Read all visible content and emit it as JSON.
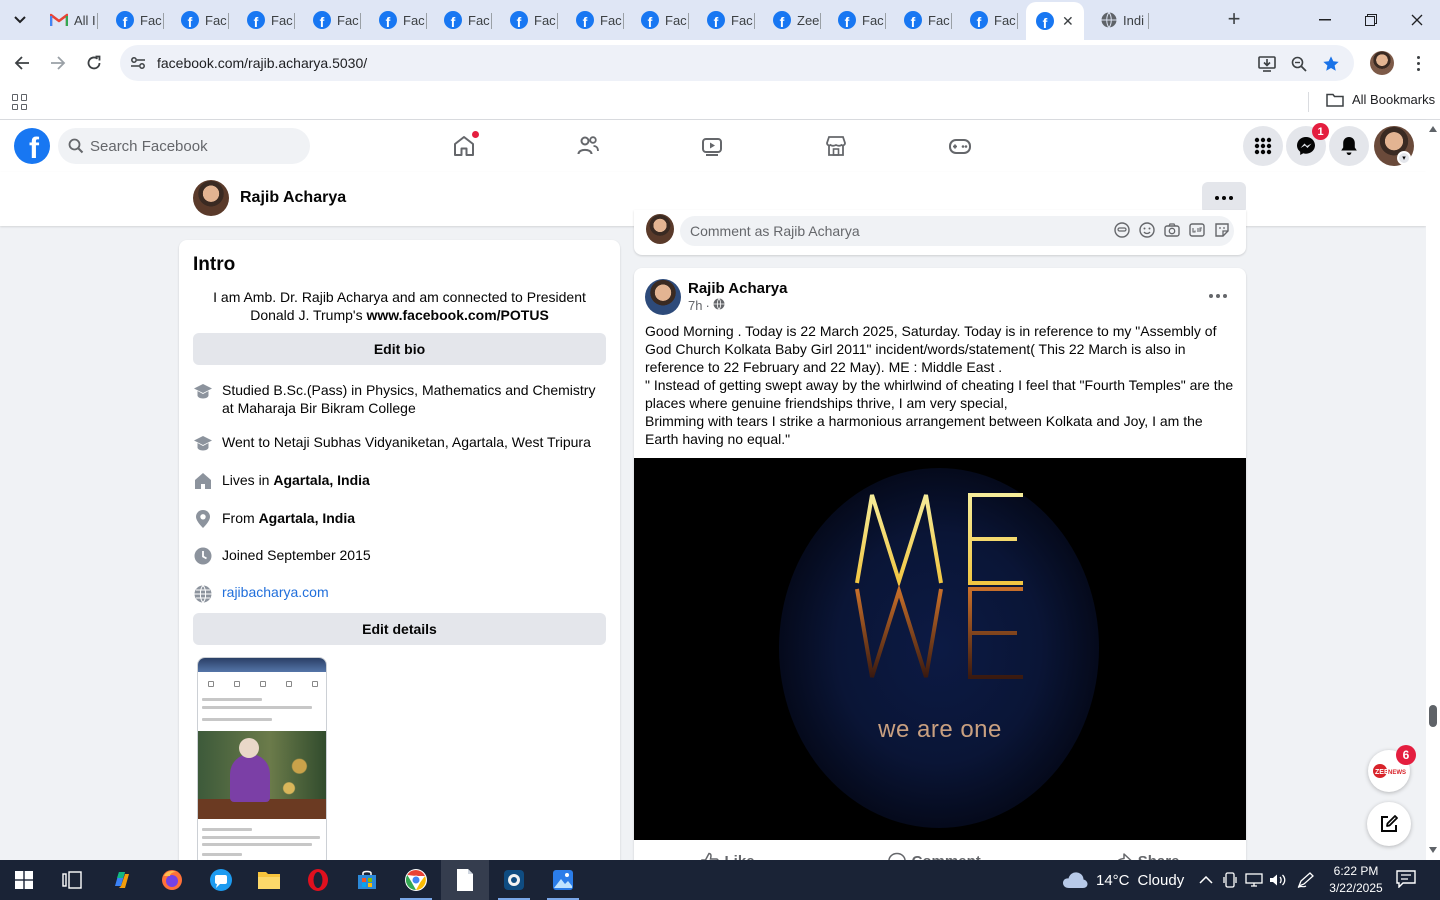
{
  "browser": {
    "tabs": [
      {
        "label": "All I",
        "type": "gmail",
        "active": false
      },
      {
        "label": "Fac",
        "type": "facebook",
        "active": false
      },
      {
        "label": "Fac",
        "type": "facebook",
        "active": false
      },
      {
        "label": "Fac",
        "type": "facebook",
        "active": false
      },
      {
        "label": "Fac",
        "type": "facebook",
        "active": false
      },
      {
        "label": "Fac",
        "type": "facebook",
        "active": false
      },
      {
        "label": "Fac",
        "type": "facebook",
        "active": false
      },
      {
        "label": "Fac",
        "type": "facebook",
        "active": false
      },
      {
        "label": "Fac",
        "type": "facebook",
        "active": false
      },
      {
        "label": "Fac",
        "type": "facebook",
        "active": false
      },
      {
        "label": "Fac",
        "type": "facebook",
        "active": false
      },
      {
        "label": "Zee",
        "type": "facebook",
        "active": false
      },
      {
        "label": "Fac",
        "type": "facebook",
        "active": false
      },
      {
        "label": "Fac",
        "type": "facebook",
        "active": false
      },
      {
        "label": "Fac",
        "type": "facebook",
        "active": false
      },
      {
        "label": "",
        "type": "facebook",
        "active": true
      },
      {
        "label": "Indi",
        "type": "globe",
        "active": false
      }
    ],
    "url": "facebook.com/rajib.acharya.5030/",
    "bookmarks_label": "All Bookmarks"
  },
  "fb_nav": {
    "search_placeholder": "Search Facebook",
    "messenger_badge": "1"
  },
  "profile": {
    "name": "Rajib Acharya"
  },
  "intro": {
    "title": "Intro",
    "bio_prefix": "I am Amb. Dr. Rajib Acharya and am connected to President Donald J. Trump's ",
    "bio_link": "www.facebook.com/POTUS",
    "edit_bio_label": "Edit bio",
    "details": [
      {
        "icon": "graduation-cap-icon",
        "text": "Studied B.Sc.(Pass) in Physics, Mathematics and Chemistry at Maharaja Bir Bikram College",
        "bold": ""
      },
      {
        "icon": "graduation-cap-icon",
        "text": "Went to Netaji Subhas Vidyaniketan, Agartala, West Tripura",
        "bold": ""
      },
      {
        "icon": "home-icon",
        "text": "Lives in ",
        "bold": "Agartala, India"
      },
      {
        "icon": "location-pin-icon",
        "text": "From ",
        "bold": "Agartala, India"
      },
      {
        "icon": "clock-icon",
        "text": "Joined September 2015",
        "bold": ""
      }
    ],
    "website": "rajibacharya.com",
    "edit_details_label": "Edit details"
  },
  "comment_box": {
    "placeholder": "Comment as Rajib Acharya"
  },
  "post": {
    "author": "Rajib Acharya",
    "time": "7h",
    "audience": "public-globe-icon",
    "paragraphs": [
      "Good Morning . Today is 22 March 2025, Saturday. Today is in reference to my \"Assembly of God Church Kolkata Baby Girl 2011\" incident/words/statement( This 22 March is also in reference to 22 February and 22 May). ME : Middle East .",
      "\" Instead of getting swept away by the whirlwind of cheating I feel that \"Fourth Temples\" are the places where genuine friendships thrive, I am very special,",
      "Brimming with tears I strike a harmonious arrangement between Kolkata and Joy, I am the Earth having no equal.\""
    ],
    "image_caption": "we are one",
    "actions": {
      "like": "Like",
      "comment": "Comment",
      "share": "Share"
    }
  },
  "floating": {
    "zee_badge": "6",
    "zee_label": "ZEE NEWS"
  },
  "taskbar": {
    "weather_temp": "14°C",
    "weather_desc": "Cloudy",
    "time": "6:22 PM",
    "date": "3/22/2025"
  },
  "colors": {
    "facebook_blue": "#1877f2",
    "badge_red": "#e41e3f",
    "link_blue": "#216fdb",
    "taskbar_bg": "#1a2336"
  }
}
